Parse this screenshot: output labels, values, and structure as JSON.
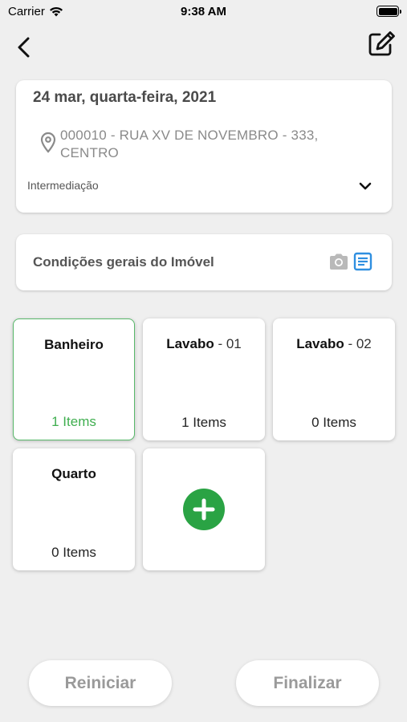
{
  "status_bar": {
    "carrier": "Carrier",
    "time": "9:38 AM"
  },
  "nav": {
    "back_icon": "chevron-left-icon",
    "edit_icon": "edit-icon"
  },
  "info": {
    "date": "24 mar, quarta-feira, 2021",
    "address": "000010 - RUA XV DE NOVEMBRO - 333, CENTRO",
    "type": "Intermediação"
  },
  "conditions": {
    "label": "Condições gerais do Imóvel"
  },
  "rooms": [
    {
      "name": "Banheiro",
      "suffix": "",
      "count": "1 Items",
      "selected": true
    },
    {
      "name": "Lavabo",
      "suffix": " - 01",
      "count": "1 Items",
      "selected": false
    },
    {
      "name": "Lavabo",
      "suffix": " - 02",
      "count": "0 Items",
      "selected": false
    },
    {
      "name": "Quarto",
      "suffix": "",
      "count": "0 Items",
      "selected": false
    }
  ],
  "actions": {
    "reset": "Reiniciar",
    "finish": "Finalizar"
  },
  "colors": {
    "accent_green": "#2aa344",
    "selected_border": "#58b86a",
    "doc_icon_blue": "#2f8fe0",
    "background": "#efefef"
  }
}
